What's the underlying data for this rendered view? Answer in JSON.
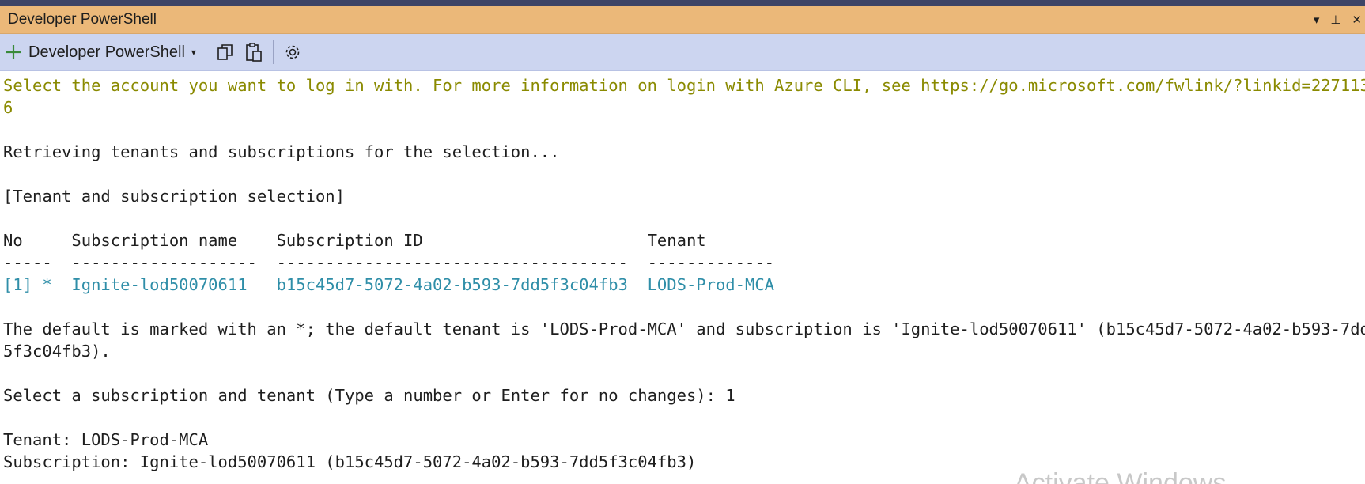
{
  "window": {
    "title": "Developer PowerShell",
    "actions": {
      "dropdown": "▾",
      "pin": "⊥",
      "close": "✕"
    }
  },
  "toolbar": {
    "new_terminal_label": "Developer PowerShell",
    "caret": "▾",
    "icons": [
      "plus-icon",
      "copy-icon",
      "paste-icon",
      "settings-gear-icon"
    ]
  },
  "console": {
    "lines": [
      "Select the account you want to log in with. For more information on login with Azure CLI, see https://go.microsoft.com/fwlink/?linkid=227113",
      "6",
      "",
      "Retrieving tenants and subscriptions for the selection...",
      "",
      "[Tenant and subscription selection]",
      "",
      "No     Subscription name    Subscription ID                       Tenant",
      "-----  -------------------  ------------------------------------  -------------",
      "[1] *  Ignite-lod50070611   b15c45d7-5072-4a02-b593-7dd5f3c04fb3  LODS-Prod-MCA",
      "",
      "The default is marked with an *; the default tenant is 'LODS-Prod-MCA' and subscription is 'Ignite-lod50070611' (b15c45d7-5072-4a02-b593-7dd",
      "5f3c04fb3).",
      "",
      "Select a subscription and tenant (Type a number or Enter for no changes): 1",
      "",
      "Tenant: LODS-Prod-MCA",
      "Subscription: Ignite-lod50070611 (b15c45d7-5072-4a02-b593-7dd5f3c04fb3)"
    ]
  },
  "watermark": "Activate Windows",
  "colors": {
    "titlebar": "#ebb879",
    "toolbar": "#ccd5f0",
    "info_text": "#8a8a00",
    "highlight_row": "#2f8ea8"
  }
}
